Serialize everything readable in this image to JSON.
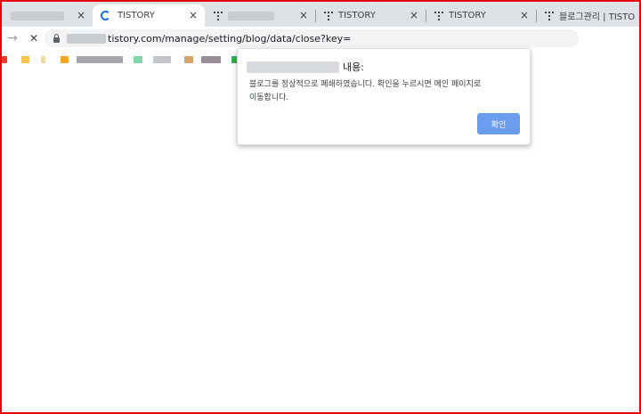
{
  "browser": {
    "tabs": [
      {
        "title": "",
        "close": "×",
        "state": "inactive"
      },
      {
        "title": "TISTORY",
        "close": "×",
        "state": "active-loading"
      },
      {
        "title": "",
        "close": "×",
        "state": "inactive"
      },
      {
        "title": "TISTORY",
        "close": "×",
        "state": "inactive"
      },
      {
        "title": "TISTORY",
        "close": "×",
        "state": "inactive"
      },
      {
        "title": "블로그관리 | TISTO",
        "close": "",
        "state": "inactive"
      }
    ],
    "toolbar": {
      "back_icon": "→",
      "stop_icon": "✕",
      "url": "tistory.com/manage/setting/blog/data/close?key="
    }
  },
  "dialog": {
    "title_suffix": "내용:",
    "message": "블로그를 정상적으로 폐쇄하였습니다. 확인을 누르시면 메인 페이지로 이동합니다.",
    "ok_label": "확인"
  },
  "colors": {
    "frame_border": "#e8000b",
    "ok_button": "#6a9cf0",
    "loading_spinner": "#1a73e8"
  },
  "icons": [
    "loading-spinner-icon",
    "tistory-favicon-icon",
    "lock-icon",
    "back-arrow-icon",
    "stop-icon",
    "close-icon"
  ]
}
